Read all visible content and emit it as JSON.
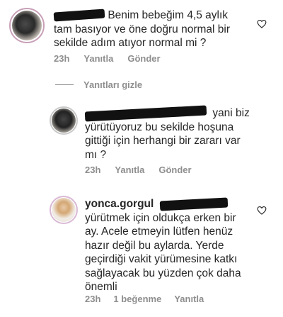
{
  "comments": [
    {
      "text": "Benim bebeğim 4,5 aylık tam basıyor ve öne doğru normal bir sekilde adım atıyor normal mi ?",
      "line1": "Benim bebeğim 4,5 aylık",
      "line2": "tam basıyor ve öne doğru normal bir",
      "line3": "sekilde adım atıyor normal mi ?",
      "time": "23h",
      "reply_label": "Yanıtla",
      "send_label": "Gönder"
    },
    {
      "line1": "yani biz",
      "line2": "yürütüyoruz bu sekilde hoşuna",
      "line3": "gittiği için herhangi bir zararı var",
      "line4": "mı ?",
      "time": "23h",
      "reply_label": "Yanıtla",
      "send_label": "Gönder"
    },
    {
      "username": "yonca.gorgul",
      "line1": "yürütmek için oldukça erken bir",
      "line2": "ay. Acele etmeyin lütfen henüz",
      "line3": "hazır değil bu aylarda. Yerde",
      "line4": "geçirdiği vakit yürümesine katkı",
      "line5": "sağlayacak bu yüzden çok daha",
      "line6": "önemli",
      "time": "23h",
      "likes_label": "1 beğenme",
      "reply_label": "Yanıtla"
    }
  ],
  "hide_replies_label": "Yanıtları gizle",
  "colors": {
    "text": "#262626",
    "meta": "#8e8e8e",
    "story_ring": "#c5a3c9"
  }
}
